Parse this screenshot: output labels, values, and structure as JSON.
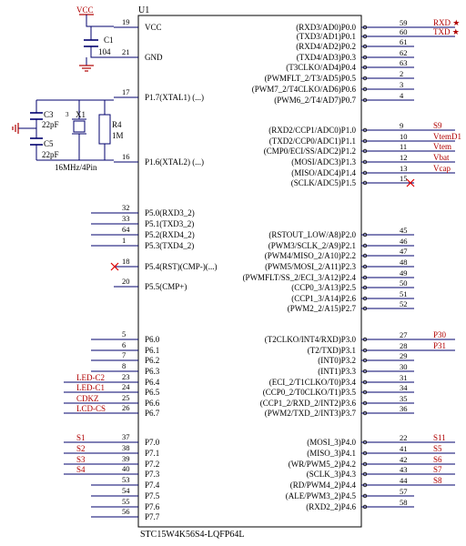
{
  "chip": {
    "ref": "U1",
    "part": "STC15W4K56S4-LQFP64L",
    "left_pins": [
      {
        "num": "19",
        "name": "VCC"
      },
      {
        "num": "21",
        "name": "GND"
      },
      {
        "num": "17",
        "name": "P1.7(XTAL1) (...)"
      },
      {
        "num": "16",
        "name": "P1.6(XTAL2) (...)"
      },
      {
        "num": "32",
        "name": "P5.0(RXD3_2)"
      },
      {
        "num": "33",
        "name": "P5.1(TXD3_2)"
      },
      {
        "num": "64",
        "name": "P5.2(RXD4_2)"
      },
      {
        "num": "1",
        "name": "P5.3(TXD4_2)"
      },
      {
        "num": "18",
        "name": "P5.4(RST)(CMP-)(...)"
      },
      {
        "num": "20",
        "name": "P5.5(CMP+)"
      },
      {
        "num": "5",
        "name": "P6.0"
      },
      {
        "num": "6",
        "name": "P6.1"
      },
      {
        "num": "7",
        "name": "P6.2"
      },
      {
        "num": "8",
        "name": "P6.3"
      },
      {
        "num": "23",
        "name": "P6.4"
      },
      {
        "num": "24",
        "name": "P6.5"
      },
      {
        "num": "25",
        "name": "P6.6"
      },
      {
        "num": "26",
        "name": "P6.7"
      },
      {
        "num": "37",
        "name": "P7.0"
      },
      {
        "num": "38",
        "name": "P7.1"
      },
      {
        "num": "39",
        "name": "P7.2"
      },
      {
        "num": "40",
        "name": "P7.3"
      },
      {
        "num": "53",
        "name": "P7.4"
      },
      {
        "num": "54",
        "name": "P7.5"
      },
      {
        "num": "55",
        "name": "P7.6"
      },
      {
        "num": "56",
        "name": "P7.7"
      }
    ],
    "right_pins": [
      {
        "num": "59",
        "name": "(RXD3/AD0)P0.0"
      },
      {
        "num": "60",
        "name": "(TXD3/AD1)P0.1"
      },
      {
        "num": "61",
        "name": "(RXD4/AD2)P0.2"
      },
      {
        "num": "62",
        "name": "(TXD4/AD3)P0.3"
      },
      {
        "num": "63",
        "name": "(T3CLKO/AD4)P0.4"
      },
      {
        "num": "2",
        "name": "(PWMFLT_2/T3/AD5)P0.5"
      },
      {
        "num": "3",
        "name": "(PWM7_2/T4CLKO/AD6)P0.6"
      },
      {
        "num": "4",
        "name": "(PWM6_2/T4/AD7)P0.7"
      },
      {
        "num": "9",
        "name": "(RXD2/CCP1/ADC0)P1.0"
      },
      {
        "num": "10",
        "name": "(TXD2/CCP0/ADC1)P1.1"
      },
      {
        "num": "11",
        "name": "(CMP0/ECI/SS/ADC2)P1.2"
      },
      {
        "num": "12",
        "name": "(MOSI/ADC3)P1.3"
      },
      {
        "num": "13",
        "name": "(MISO/ADC4)P1.4"
      },
      {
        "num": "15",
        "name": "(SCLK/ADC5)P1.5"
      },
      {
        "num": "45",
        "name": "(RSTOUT_LOW/A8)P2.0"
      },
      {
        "num": "46",
        "name": "(PWM3/SCLK_2/A9)P2.1"
      },
      {
        "num": "47",
        "name": "(PWM4/MISO_2/A10)P2.2"
      },
      {
        "num": "48",
        "name": "(PWM5/MOSI_2/A11)P2.3"
      },
      {
        "num": "49",
        "name": "(PWMFLT/SS_2/ECI_3/A12)P2.4"
      },
      {
        "num": "50",
        "name": "(CCP0_3/A13)P2.5"
      },
      {
        "num": "51",
        "name": "(CCP1_3/A14)P2.6"
      },
      {
        "num": "52",
        "name": "(PWM2_2/A15)P2.7"
      },
      {
        "num": "27",
        "name": "(T2CLKO/INT4/RXD)P3.0"
      },
      {
        "num": "28",
        "name": "(T2/TXD)P3.1"
      },
      {
        "num": "29",
        "name": "(INT0)P3.2"
      },
      {
        "num": "30",
        "name": "(INT1)P3.3"
      },
      {
        "num": "31",
        "name": "(ECI_2/T1CLKO/T0)P3.4"
      },
      {
        "num": "34",
        "name": "(CCP0_2/T0CLKO/T1)P3.5"
      },
      {
        "num": "35",
        "name": "(CCP1_2/RXD_2/INT2)P3.6"
      },
      {
        "num": "36",
        "name": "(PWM2/TXD_2/INT3)P3.7"
      },
      {
        "num": "22",
        "name": "(MOSI_3)P4.0"
      },
      {
        "num": "41",
        "name": "(MISO_3)P4.1"
      },
      {
        "num": "42",
        "name": "(WR/PWM5_2)P4.2"
      },
      {
        "num": "43",
        "name": "(SCLK_3)P4.3"
      },
      {
        "num": "44",
        "name": "(RD/PWM4_2)P4.4"
      },
      {
        "num": "57",
        "name": "(ALE/PWM3_2)P4.5"
      },
      {
        "num": "58",
        "name": "(RXD2_2)P4.6"
      }
    ]
  },
  "right_nets": [
    {
      "text": "RXD ★",
      "pin": "59"
    },
    {
      "text": "TXD ★",
      "pin": "60"
    },
    {
      "text": "S9",
      "pin": "9"
    },
    {
      "text": "VtemD1",
      "pin": "10"
    },
    {
      "text": "Vtem",
      "pin": "11"
    },
    {
      "text": "Vbat",
      "pin": "12"
    },
    {
      "text": "Vcap",
      "pin": "13"
    },
    {
      "text": "P30",
      "pin": "27"
    },
    {
      "text": "P31",
      "pin": "28"
    },
    {
      "text": "S11",
      "pin": "22"
    },
    {
      "text": "S5",
      "pin": "41"
    },
    {
      "text": "S6",
      "pin": "42"
    },
    {
      "text": "S7",
      "pin": "43"
    },
    {
      "text": "S8",
      "pin": "44"
    }
  ],
  "left_nets": [
    {
      "text": "LED-C2",
      "pin": "23"
    },
    {
      "text": "LED-C1",
      "pin": "24"
    },
    {
      "text": "CDKZ",
      "pin": "25"
    },
    {
      "text": "LCD-CS",
      "pin": "26"
    },
    {
      "text": "S1",
      "pin": "37"
    },
    {
      "text": "S2",
      "pin": "38"
    },
    {
      "text": "S3",
      "pin": "39"
    },
    {
      "text": "S4",
      "pin": "40"
    }
  ],
  "power": {
    "vcc_label": "VCC",
    "c1_ref": "C1",
    "c1_val": "104"
  },
  "crystal": {
    "c3_ref": "C3",
    "c3_val": "22pF",
    "c5_ref": "C5",
    "c5_val": "22pF",
    "x1_ref": "X1",
    "r4_ref": "R4",
    "r4_val": "1M",
    "pin3": "3",
    "caption": "16MHz/4Pin"
  },
  "colors": {
    "wire": "#00006e",
    "net": "#b00000",
    "marker": "#e00000"
  }
}
